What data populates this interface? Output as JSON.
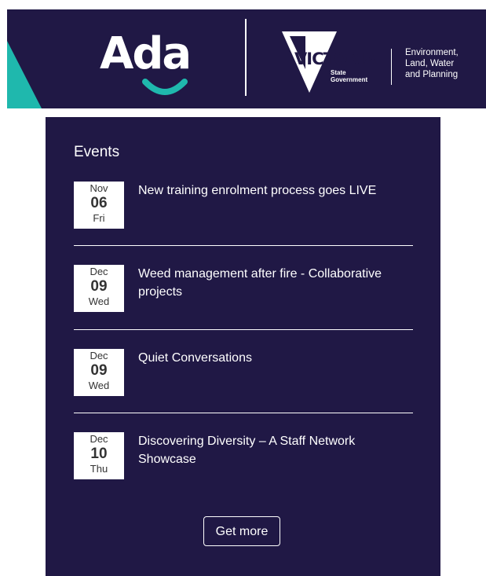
{
  "banner": {
    "ada_logo_text": "Ada",
    "vic_wordmark": "VICTORIA",
    "vic_sub_line1": "State",
    "vic_sub_line2": "Government",
    "dept_line1": "Environment,",
    "dept_line2": "Land, Water",
    "dept_line3": "and Planning",
    "colors": {
      "navy": "#201845",
      "teal": "#1fb8ad",
      "smile": "#1fb8ad"
    }
  },
  "events": {
    "heading": "Events",
    "items": [
      {
        "month": "Nov",
        "day": "06",
        "weekday": "Fri",
        "title": "New training enrolment process goes LIVE"
      },
      {
        "month": "Dec",
        "day": "09",
        "weekday": "Wed",
        "title": "Weed management after fire - Collaborative projects"
      },
      {
        "month": "Dec",
        "day": "09",
        "weekday": "Wed",
        "title": "Quiet Conversations"
      },
      {
        "month": "Dec",
        "day": "10",
        "weekday": "Thu",
        "title": "Discovering Diversity – A Staff Network Showcase"
      }
    ],
    "more_button": "Get more"
  }
}
